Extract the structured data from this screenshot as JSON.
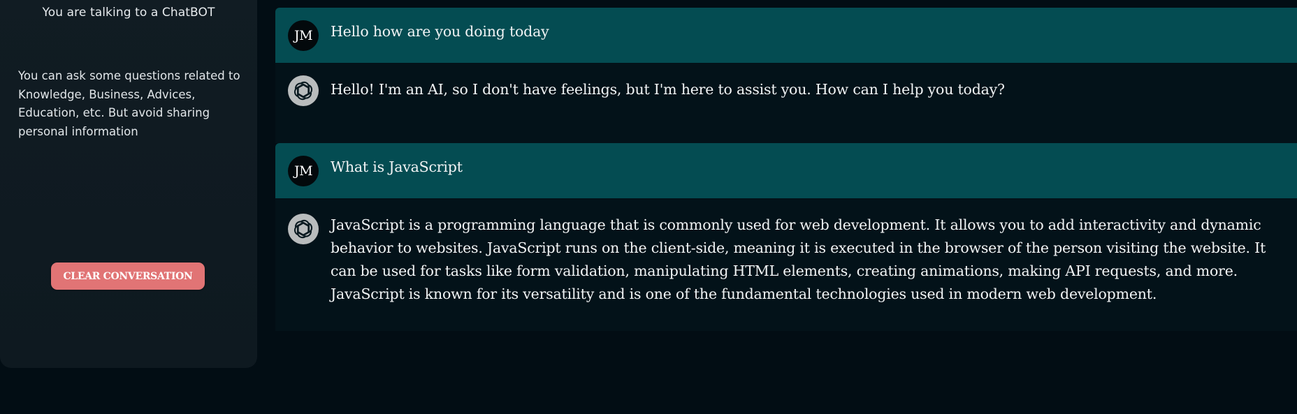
{
  "sidebar": {
    "title": "You are talking to a ChatBOT",
    "description": "You can ask some questions related to Knowledge, Business, Advices, Education, etc. But avoid sharing personal information",
    "clear_button_label": "CLEAR CONVERSATION"
  },
  "chat": {
    "messages": [
      {
        "role": "user",
        "avatar_initials": "JM",
        "text": "Hello how are you doing today"
      },
      {
        "role": "assistant",
        "avatar_icon": "openai-logo-icon",
        "text": "Hello! I'm an AI, so I don't have feelings, but I'm here to assist you. How can I help you today?"
      },
      {
        "role": "user",
        "avatar_initials": "JM",
        "text": "What is JavaScript"
      },
      {
        "role": "assistant",
        "avatar_icon": "openai-logo-icon",
        "text": "JavaScript is a programming language that is commonly used for web development. It allows you to add interactivity and dynamic behavior to websites. JavaScript runs on the client-side, meaning it is executed in the browser of the person visiting the website. It can be used for tasks like form validation, manipulating HTML elements, creating animations, making API requests, and more. JavaScript is known for its versatility and is one of the fundamental technologies used in modern web development."
      }
    ]
  },
  "colors": {
    "page_background": "#020d14",
    "sidebar_background": "#111c23",
    "user_message_background": "#044c52",
    "assistant_message_background": "#031219",
    "clear_button": "#e17475",
    "text": "#f1f3f4"
  }
}
